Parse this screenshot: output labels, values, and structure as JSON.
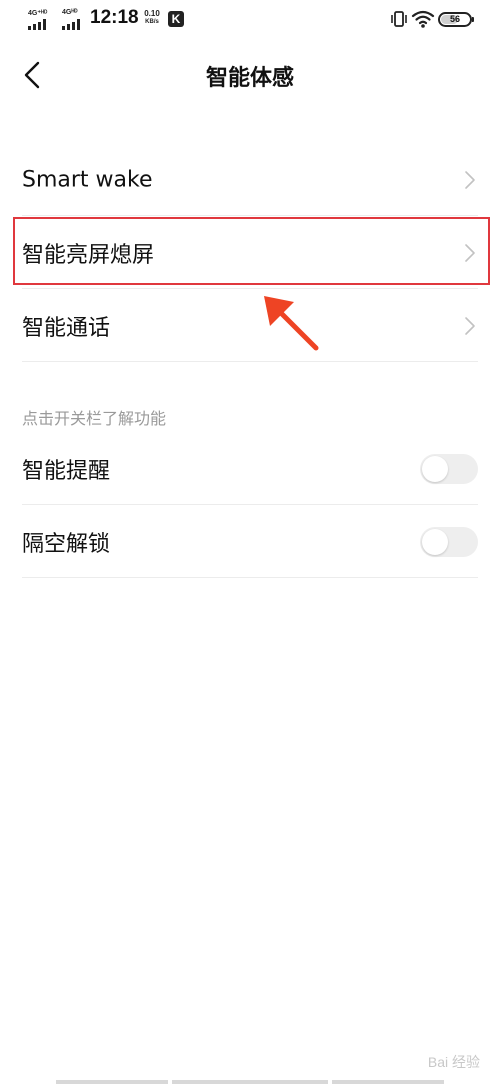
{
  "status_bar": {
    "sim1_label": "4G⁺ᴴᴰ",
    "sim2_label": "4Gᴴᴰ",
    "time": "12:18",
    "net_speed_value": "0.10",
    "net_speed_unit": "KB/s",
    "app_badge": "K",
    "battery_percent": "56",
    "icons": [
      "signal-icon",
      "vibrate-icon",
      "wifi-icon",
      "battery-icon"
    ]
  },
  "header": {
    "title": "智能体感",
    "back_icon": "back-chevron-icon"
  },
  "menu": {
    "items": [
      {
        "label": "Smart wake"
      },
      {
        "label": "智能亮屏熄屏"
      },
      {
        "label": "智能通话"
      }
    ]
  },
  "toggles_section": {
    "header": "点击开关栏了解功能",
    "items": [
      {
        "label": "智能提醒",
        "enabled": false
      },
      {
        "label": "隔空解锁",
        "enabled": false
      }
    ]
  },
  "annotation": {
    "highlight_color": "#e0383e",
    "arrow_color": "#ee4424",
    "arrow_icon": "arrow-icon"
  },
  "watermark": {
    "text": "Bai 经验"
  }
}
